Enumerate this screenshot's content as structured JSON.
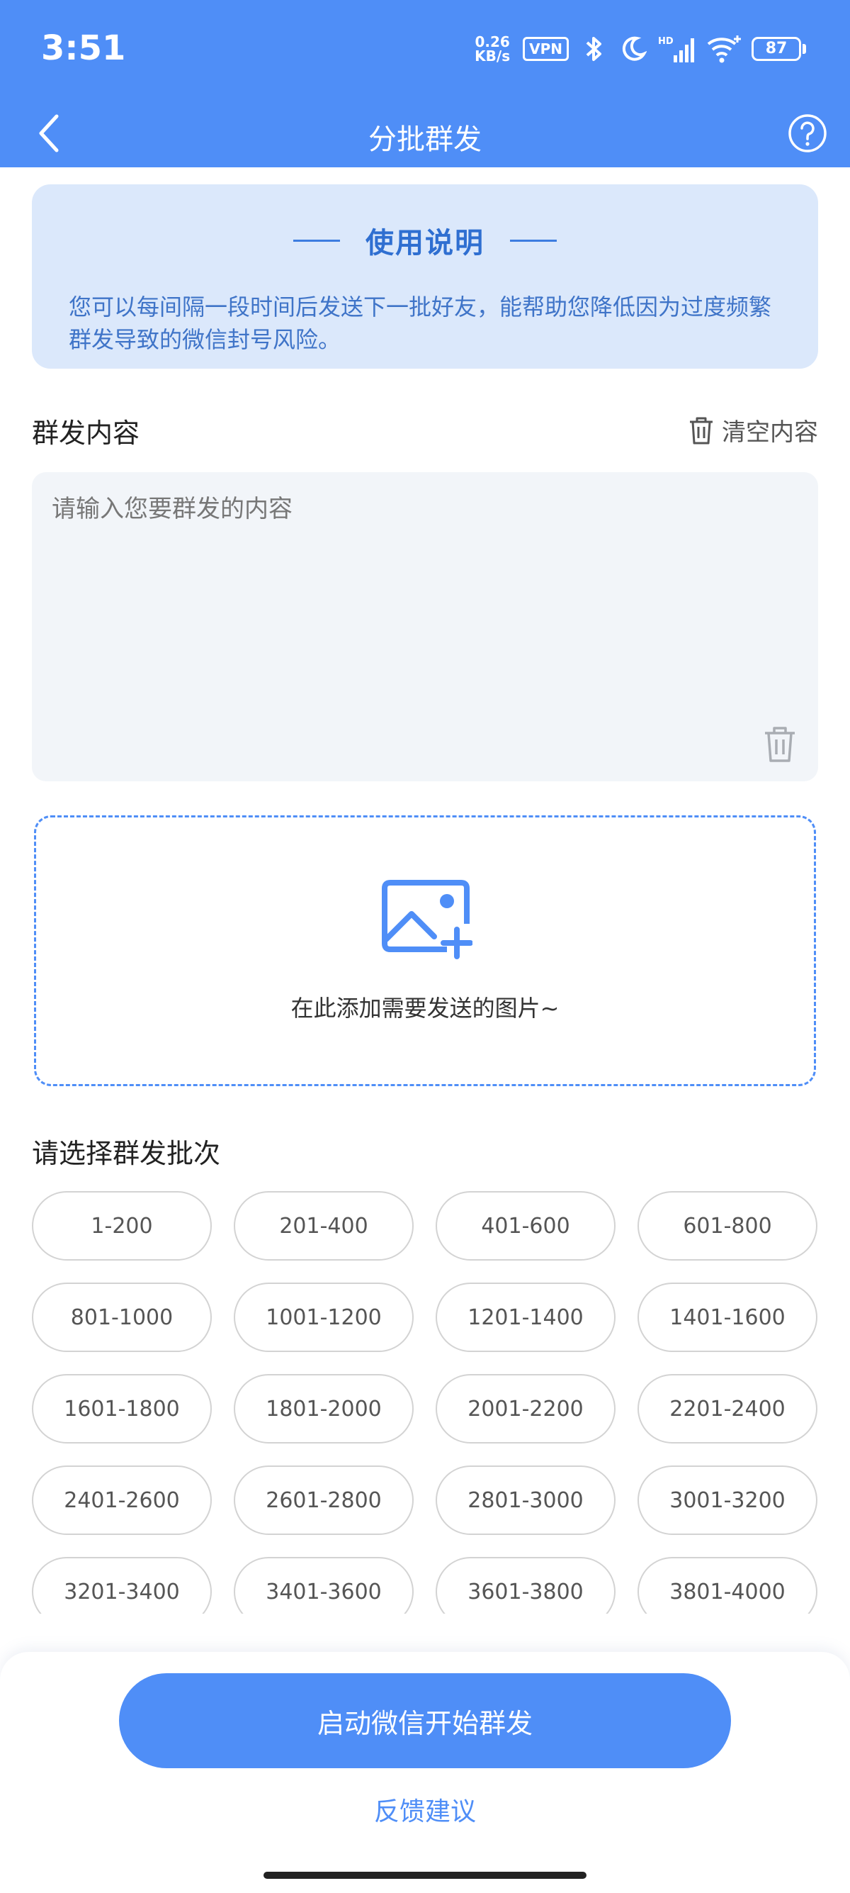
{
  "status_bar": {
    "time": "3:51",
    "net_speed_value": "0.26",
    "net_speed_unit": "KB/s",
    "vpn": "VPN",
    "signal_label": "HD",
    "battery": "87"
  },
  "nav": {
    "title": "分批群发"
  },
  "usage": {
    "title": "使用说明",
    "description": "您可以每间隔一段时间后发送下一批好友，能帮助您降低因为过度频繁群发导致的微信封号风险。"
  },
  "content_section": {
    "label": "群发内容",
    "clear_label": "清空内容",
    "placeholder": "请输入您要群发的内容",
    "value": ""
  },
  "image_upload": {
    "text": "在此添加需要发送的图片~"
  },
  "batch_section": {
    "label": "请选择群发批次",
    "batches": [
      "1-200",
      "201-400",
      "401-600",
      "601-800",
      "801-1000",
      "1001-1200",
      "1201-1400",
      "1401-1600",
      "1601-1800",
      "1801-2000",
      "2001-2200",
      "2201-2400",
      "2401-2600",
      "2601-2800",
      "2801-3000",
      "3001-3200",
      "3201-3400",
      "3401-3600",
      "3601-3800",
      "3801-4000"
    ]
  },
  "bottom": {
    "start_label": "启动微信开始群发",
    "feedback_label": "反馈建议"
  },
  "colors": {
    "primary": "#4f8ef7",
    "info_bg": "#dbe8fb",
    "info_text": "#3f74c8"
  }
}
